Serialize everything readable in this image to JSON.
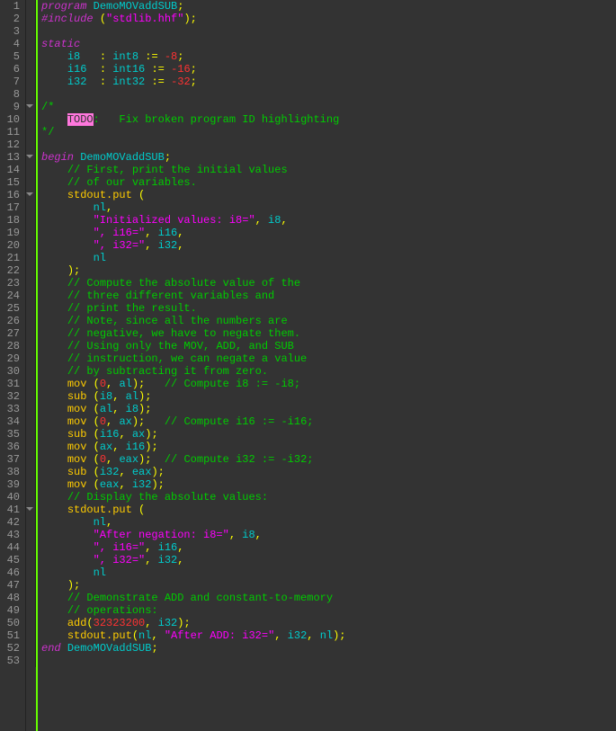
{
  "lineCount": 53,
  "foldMarks": [
    {
      "line": 9,
      "type": "down"
    },
    {
      "line": 13,
      "type": "down"
    },
    {
      "line": 16,
      "type": "down"
    },
    {
      "line": 41,
      "type": "down"
    }
  ],
  "lines": [
    [
      [
        "kw",
        "program"
      ],
      [
        "",
        ""
      ],
      [
        "id",
        " DemoMOVaddSUB"
      ],
      [
        "op",
        ";"
      ]
    ],
    [
      [
        "inc",
        "#include"
      ],
      [
        "",
        " "
      ],
      [
        "op",
        "("
      ],
      [
        "str",
        "\"stdlib.hhf\""
      ],
      [
        "op",
        ")"
      ],
      [
        "op",
        ";"
      ]
    ],
    [],
    [
      [
        "kw",
        "static"
      ]
    ],
    [
      [
        "",
        "    "
      ],
      [
        "id",
        "i8"
      ],
      [
        "",
        "   "
      ],
      [
        "op",
        ":"
      ],
      [
        "",
        " "
      ],
      [
        "type",
        "int8 "
      ],
      [
        "op",
        ":="
      ],
      [
        "",
        " "
      ],
      [
        "num",
        "-8"
      ],
      [
        "op",
        ";"
      ]
    ],
    [
      [
        "",
        "    "
      ],
      [
        "id",
        "i16"
      ],
      [
        "",
        "  "
      ],
      [
        "op",
        ":"
      ],
      [
        "",
        " "
      ],
      [
        "type",
        "int16 "
      ],
      [
        "op",
        ":="
      ],
      [
        "",
        " "
      ],
      [
        "num",
        "-16"
      ],
      [
        "op",
        ";"
      ]
    ],
    [
      [
        "",
        "    "
      ],
      [
        "id",
        "i32"
      ],
      [
        "",
        "  "
      ],
      [
        "op",
        ":"
      ],
      [
        "",
        " "
      ],
      [
        "type",
        "int32 "
      ],
      [
        "op",
        ":="
      ],
      [
        "",
        " "
      ],
      [
        "num",
        "-32"
      ],
      [
        "op",
        ";"
      ]
    ],
    [],
    [
      [
        "cm",
        "/*"
      ]
    ],
    [
      [
        "",
        "    "
      ],
      [
        "todo",
        "TODO"
      ],
      [
        "cm",
        ":   Fix broken program ID highlighting"
      ]
    ],
    [
      [
        "cm",
        "*/"
      ]
    ],
    [],
    [
      [
        "kw",
        "begin"
      ],
      [
        "",
        " "
      ],
      [
        "id",
        "DemoMOVaddSUB"
      ],
      [
        "op",
        ";"
      ]
    ],
    [
      [
        "",
        "    "
      ],
      [
        "cm",
        "// First, print the initial values"
      ]
    ],
    [
      [
        "",
        "    "
      ],
      [
        "cm",
        "// of our variables."
      ]
    ],
    [
      [
        "",
        "    "
      ],
      [
        "func",
        "stdout.put"
      ],
      [
        "",
        " "
      ],
      [
        "op",
        "("
      ]
    ],
    [
      [
        "",
        "        "
      ],
      [
        "id",
        "nl"
      ],
      [
        "op",
        ","
      ]
    ],
    [
      [
        "",
        "        "
      ],
      [
        "str",
        "\"Initialized values: i8=\""
      ],
      [
        "op",
        ","
      ],
      [
        "",
        " "
      ],
      [
        "id",
        "i8"
      ],
      [
        "op",
        ","
      ]
    ],
    [
      [
        "",
        "        "
      ],
      [
        "str",
        "\", i16=\""
      ],
      [
        "op",
        ","
      ],
      [
        "",
        " "
      ],
      [
        "id",
        "i16"
      ],
      [
        "op",
        ","
      ]
    ],
    [
      [
        "",
        "        "
      ],
      [
        "str",
        "\", i32=\""
      ],
      [
        "op",
        ","
      ],
      [
        "",
        " "
      ],
      [
        "id",
        "i32"
      ],
      [
        "op",
        ","
      ]
    ],
    [
      [
        "",
        "        "
      ],
      [
        "id",
        "nl"
      ]
    ],
    [
      [
        "",
        "    "
      ],
      [
        "op",
        ")"
      ],
      [
        "op",
        ";"
      ]
    ],
    [
      [
        "",
        "    "
      ],
      [
        "cm",
        "// Compute the absolute value of the"
      ]
    ],
    [
      [
        "",
        "    "
      ],
      [
        "cm",
        "// three different variables and"
      ]
    ],
    [
      [
        "",
        "    "
      ],
      [
        "cm",
        "// print the result."
      ]
    ],
    [
      [
        "",
        "    "
      ],
      [
        "cm",
        "// Note, since all the numbers are"
      ]
    ],
    [
      [
        "",
        "    "
      ],
      [
        "cm",
        "// negative, we have to negate them."
      ]
    ],
    [
      [
        "",
        "    "
      ],
      [
        "cm",
        "// Using only the MOV, ADD, and SUB"
      ]
    ],
    [
      [
        "",
        "    "
      ],
      [
        "cm",
        "// instruction, we can negate a value"
      ]
    ],
    [
      [
        "",
        "    "
      ],
      [
        "cm",
        "// by subtracting it from zero."
      ]
    ],
    [
      [
        "",
        "    "
      ],
      [
        "func",
        "mov"
      ],
      [
        "",
        " "
      ],
      [
        "op",
        "("
      ],
      [
        "num",
        "0"
      ],
      [
        "op",
        ","
      ],
      [
        "",
        " "
      ],
      [
        "id",
        "al"
      ],
      [
        "op",
        ")"
      ],
      [
        "op",
        ";"
      ],
      [
        "",
        "   "
      ],
      [
        "cm",
        "// Compute i8 := -i8;"
      ]
    ],
    [
      [
        "",
        "    "
      ],
      [
        "func",
        "sub"
      ],
      [
        "",
        " "
      ],
      [
        "op",
        "("
      ],
      [
        "id",
        "i8"
      ],
      [
        "op",
        ","
      ],
      [
        "",
        " "
      ],
      [
        "id",
        "al"
      ],
      [
        "op",
        ")"
      ],
      [
        "op",
        ";"
      ]
    ],
    [
      [
        "",
        "    "
      ],
      [
        "func",
        "mov"
      ],
      [
        "",
        " "
      ],
      [
        "op",
        "("
      ],
      [
        "id",
        "al"
      ],
      [
        "op",
        ","
      ],
      [
        "",
        " "
      ],
      [
        "id",
        "i8"
      ],
      [
        "op",
        ")"
      ],
      [
        "op",
        ";"
      ]
    ],
    [
      [
        "",
        "    "
      ],
      [
        "func",
        "mov"
      ],
      [
        "",
        " "
      ],
      [
        "op",
        "("
      ],
      [
        "num",
        "0"
      ],
      [
        "op",
        ","
      ],
      [
        "",
        " "
      ],
      [
        "id",
        "ax"
      ],
      [
        "op",
        ")"
      ],
      [
        "op",
        ";"
      ],
      [
        "",
        "   "
      ],
      [
        "cm",
        "// Compute i16 := -i16;"
      ]
    ],
    [
      [
        "",
        "    "
      ],
      [
        "func",
        "sub"
      ],
      [
        "",
        " "
      ],
      [
        "op",
        "("
      ],
      [
        "id",
        "i16"
      ],
      [
        "op",
        ","
      ],
      [
        "",
        " "
      ],
      [
        "id",
        "ax"
      ],
      [
        "op",
        ")"
      ],
      [
        "op",
        ";"
      ]
    ],
    [
      [
        "",
        "    "
      ],
      [
        "func",
        "mov"
      ],
      [
        "",
        " "
      ],
      [
        "op",
        "("
      ],
      [
        "id",
        "ax"
      ],
      [
        "op",
        ","
      ],
      [
        "",
        " "
      ],
      [
        "id",
        "i16"
      ],
      [
        "op",
        ")"
      ],
      [
        "op",
        ";"
      ]
    ],
    [
      [
        "",
        "    "
      ],
      [
        "func",
        "mov"
      ],
      [
        "",
        " "
      ],
      [
        "op",
        "("
      ],
      [
        "num",
        "0"
      ],
      [
        "op",
        ","
      ],
      [
        "",
        " "
      ],
      [
        "id",
        "eax"
      ],
      [
        "op",
        ")"
      ],
      [
        "op",
        ";"
      ],
      [
        "",
        "  "
      ],
      [
        "cm",
        "// Compute i32 := -i32;"
      ]
    ],
    [
      [
        "",
        "    "
      ],
      [
        "func",
        "sub"
      ],
      [
        "",
        " "
      ],
      [
        "op",
        "("
      ],
      [
        "id",
        "i32"
      ],
      [
        "op",
        ","
      ],
      [
        "",
        " "
      ],
      [
        "id",
        "eax"
      ],
      [
        "op",
        ")"
      ],
      [
        "op",
        ";"
      ]
    ],
    [
      [
        "",
        "    "
      ],
      [
        "func",
        "mov"
      ],
      [
        "",
        " "
      ],
      [
        "op",
        "("
      ],
      [
        "id",
        "eax"
      ],
      [
        "op",
        ","
      ],
      [
        "",
        " "
      ],
      [
        "id",
        "i32"
      ],
      [
        "op",
        ")"
      ],
      [
        "op",
        ";"
      ]
    ],
    [
      [
        "",
        "    "
      ],
      [
        "cm",
        "// Display the absolute values:"
      ]
    ],
    [
      [
        "",
        "    "
      ],
      [
        "func",
        "stdout.put"
      ],
      [
        "",
        " "
      ],
      [
        "op",
        "("
      ]
    ],
    [
      [
        "",
        "        "
      ],
      [
        "id",
        "nl"
      ],
      [
        "op",
        ","
      ]
    ],
    [
      [
        "",
        "        "
      ],
      [
        "str",
        "\"After negation: i8=\""
      ],
      [
        "op",
        ","
      ],
      [
        "",
        " "
      ],
      [
        "id",
        "i8"
      ],
      [
        "op",
        ","
      ]
    ],
    [
      [
        "",
        "        "
      ],
      [
        "str",
        "\", i16=\""
      ],
      [
        "op",
        ","
      ],
      [
        "",
        " "
      ],
      [
        "id",
        "i16"
      ],
      [
        "op",
        ","
      ]
    ],
    [
      [
        "",
        "        "
      ],
      [
        "str",
        "\", i32=\""
      ],
      [
        "op",
        ","
      ],
      [
        "",
        " "
      ],
      [
        "id",
        "i32"
      ],
      [
        "op",
        ","
      ]
    ],
    [
      [
        "",
        "        "
      ],
      [
        "id",
        "nl"
      ]
    ],
    [
      [
        "",
        "    "
      ],
      [
        "op",
        ")"
      ],
      [
        "op",
        ";"
      ]
    ],
    [
      [
        "",
        "    "
      ],
      [
        "cm",
        "// Demonstrate ADD and constant-to-memory"
      ]
    ],
    [
      [
        "",
        "    "
      ],
      [
        "cm",
        "// operations:"
      ]
    ],
    [
      [
        "",
        "    "
      ],
      [
        "func",
        "add"
      ],
      [
        "op",
        "("
      ],
      [
        "num",
        "32323200"
      ],
      [
        "op",
        ","
      ],
      [
        "",
        " "
      ],
      [
        "id",
        "i32"
      ],
      [
        "op",
        ")"
      ],
      [
        "op",
        ";"
      ]
    ],
    [
      [
        "",
        "    "
      ],
      [
        "func",
        "stdout.put"
      ],
      [
        "op",
        "("
      ],
      [
        "id",
        "nl"
      ],
      [
        "op",
        ","
      ],
      [
        "",
        " "
      ],
      [
        "str",
        "\"After ADD: i32=\""
      ],
      [
        "op",
        ","
      ],
      [
        "",
        " "
      ],
      [
        "id",
        "i32"
      ],
      [
        "op",
        ","
      ],
      [
        "",
        " "
      ],
      [
        "id",
        "nl"
      ],
      [
        "op",
        ")"
      ],
      [
        "op",
        ";"
      ]
    ],
    [
      [
        "kw",
        "end"
      ],
      [
        "",
        " "
      ],
      [
        "id",
        "DemoMOVaddSUB"
      ],
      [
        "op",
        ";"
      ]
    ],
    []
  ]
}
